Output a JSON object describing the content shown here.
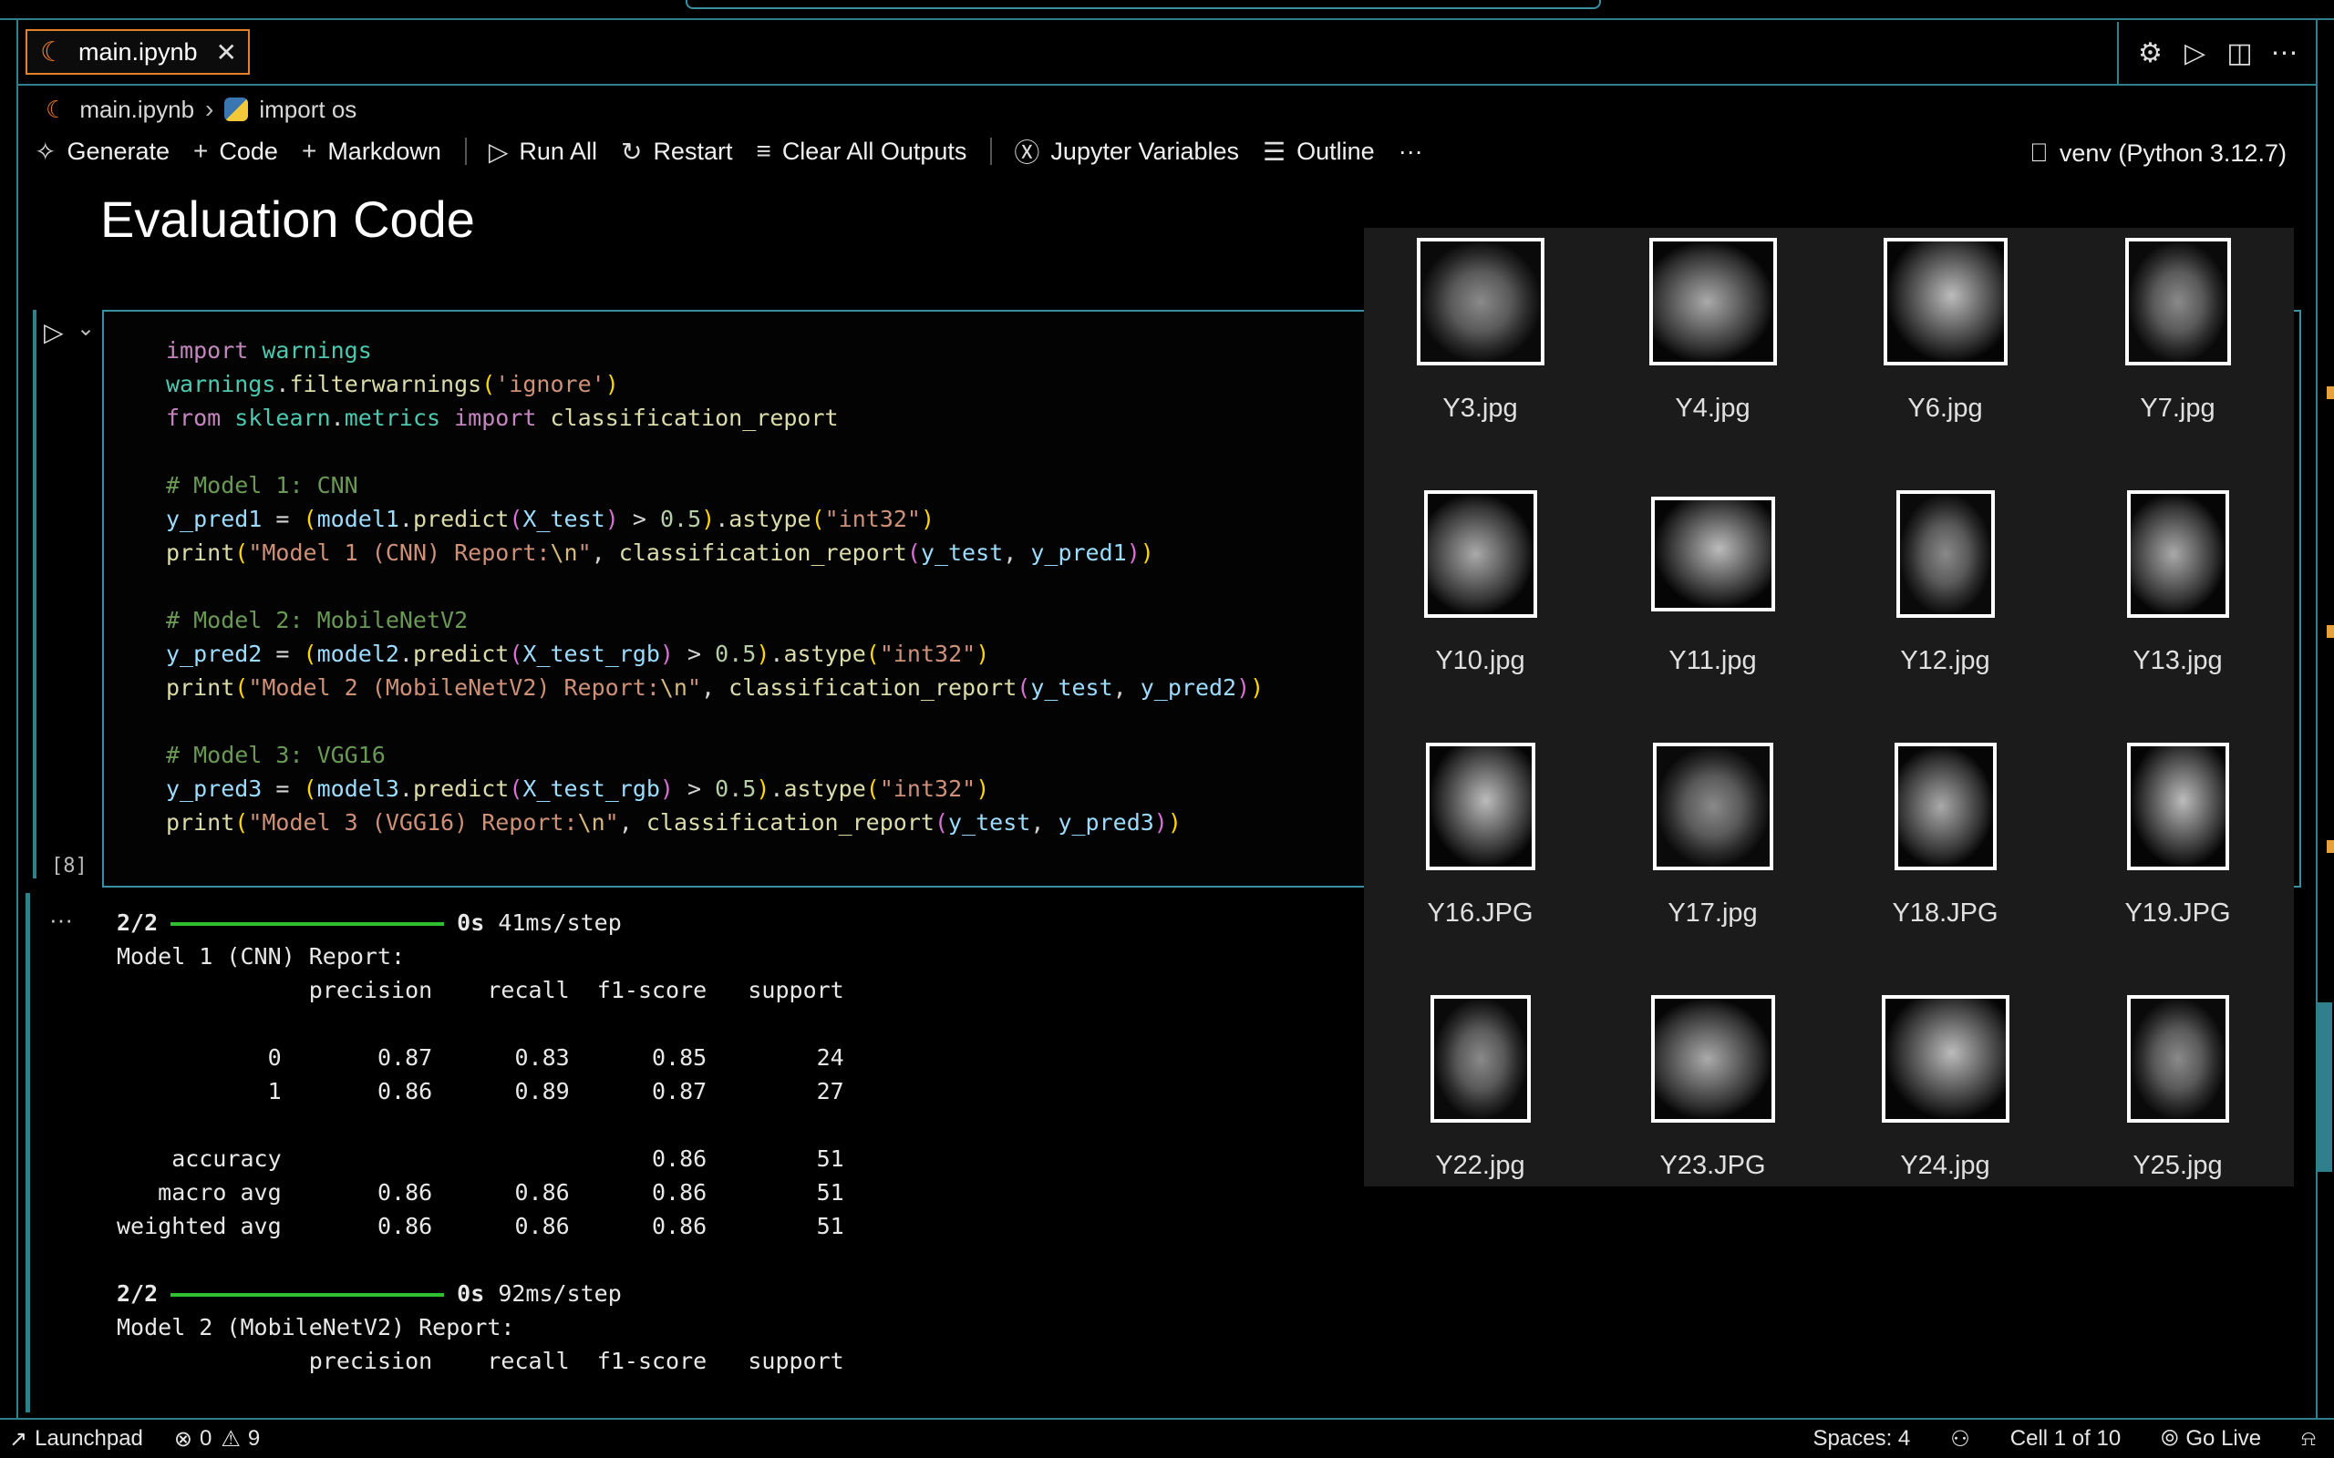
{
  "tab": {
    "label": "main.ipynb"
  },
  "breadcrumb": {
    "file": "main.ipynb",
    "symbol": "import os"
  },
  "toolbar": {
    "generate": "Generate",
    "code": "Code",
    "markdown": "Markdown",
    "run_all": "Run All",
    "restart": "Restart",
    "clear_outputs": "Clear All Outputs",
    "variables": "Jupyter Variables",
    "outline": "Outline",
    "more": "···",
    "kernel": "venv (Python 3.12.7)"
  },
  "markdown_heading": "Evaluation Code",
  "cell": {
    "exec_count": "[8]",
    "code_lines": [
      "import warnings",
      "warnings.filterwarnings('ignore')",
      "from sklearn.metrics import classification_report",
      "",
      "# Model 1: CNN",
      "y_pred1 = (model1.predict(X_test) > 0.5).astype(\"int32\")",
      "print(\"Model 1 (CNN) Report:\\n\", classification_report(y_test, y_pred1))",
      "",
      "# Model 2: MobileNetV2",
      "y_pred2 = (model2.predict(X_test_rgb) > 0.5).astype(\"int32\")",
      "print(\"Model 2 (MobileNetV2) Report:\\n\", classification_report(y_test, y_pred2))",
      "",
      "# Model 3: VGG16",
      "y_pred3 = (model3.predict(X_test_rgb) > 0.5).astype(\"int32\")",
      "print(\"Model 3 (VGG16) Report:\\n\", classification_report(y_test, y_pred3))"
    ]
  },
  "output": {
    "more": "···",
    "progress1": {
      "steps": "2/2",
      "time": "0s",
      "rate": "41ms/step"
    },
    "report1_title": "Model 1 (CNN) Report:",
    "report_header": "              precision    recall  f1-score   support",
    "report1_rows": [
      "",
      "           0       0.87      0.83      0.85        24",
      "           1       0.86      0.89      0.87        27",
      "",
      "    accuracy                           0.86        51",
      "   macro avg       0.86      0.86      0.86        51",
      "weighted avg       0.86      0.86      0.86        51",
      ""
    ],
    "progress2": {
      "steps": "2/2",
      "time": "0s",
      "rate": "92ms/step"
    },
    "report2_title": "Model 2 (MobileNetV2) Report:",
    "report2_header": "              precision    recall  f1-score   support"
  },
  "preview": {
    "images": [
      "Y3.jpg",
      "Y4.jpg",
      "Y6.jpg",
      "Y7.jpg",
      "Y10.jpg",
      "Y11.jpg",
      "Y12.jpg",
      "Y13.jpg",
      "Y16.JPG",
      "Y17.jpg",
      "Y18.JPG",
      "Y19.JPG",
      "Y22.jpg",
      "Y23.JPG",
      "Y24.jpg",
      "Y25.jpg"
    ]
  },
  "statusbar": {
    "launchpad": "Launchpad",
    "errors": "0",
    "warnings": "9",
    "spaces": "Spaces: 4",
    "cell": "Cell 1 of 10",
    "golive": "Go Live"
  },
  "colors": {
    "accent": "#2f7f8c",
    "tab_border": "#e5812c",
    "progress": "#2fbf2f"
  }
}
